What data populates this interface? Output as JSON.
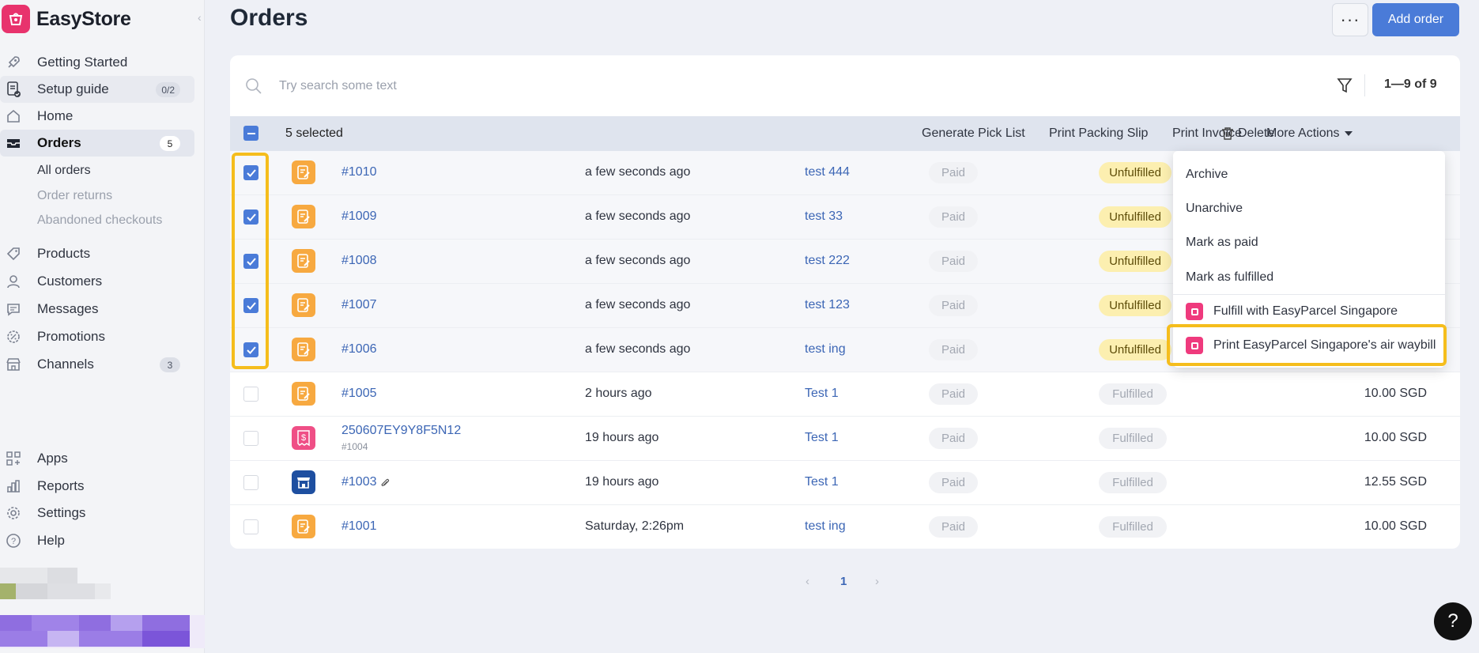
{
  "brand": {
    "name": "EasyStore"
  },
  "sidebar": {
    "items": [
      {
        "label": "Getting Started",
        "icon": "rocket-icon"
      },
      {
        "label": "Setup guide",
        "icon": "checklist-icon",
        "badge": "0/2"
      },
      {
        "label": "Home",
        "icon": "home-icon"
      },
      {
        "label": "Orders",
        "icon": "inbox-icon",
        "badge": "5"
      },
      {
        "label": "Products",
        "icon": "tag-icon"
      },
      {
        "label": "Customers",
        "icon": "user-icon"
      },
      {
        "label": "Messages",
        "icon": "chat-icon"
      },
      {
        "label": "Promotions",
        "icon": "gear-badge-icon"
      },
      {
        "label": "Channels",
        "icon": "store-icon",
        "badge": "3"
      },
      {
        "label": "Apps",
        "icon": "apps-icon"
      },
      {
        "label": "Reports",
        "icon": "chart-icon"
      },
      {
        "label": "Settings",
        "icon": "settings-icon"
      },
      {
        "label": "Help",
        "icon": "help-icon"
      }
    ],
    "orders_sub": [
      "All orders",
      "Order returns",
      "Abandoned checkouts"
    ]
  },
  "header": {
    "title": "Orders",
    "more_label": "···",
    "add_label": "Add order"
  },
  "search": {
    "placeholder": "Try search some text",
    "count": "1—9 of 9"
  },
  "bulk": {
    "selected": "5 selected",
    "actions": [
      "Generate Pick List",
      "Print Packing Slip",
      "Print Invoice",
      "More Actions",
      "Delete"
    ]
  },
  "orders": [
    {
      "id": "#1010",
      "time": "a few seconds ago",
      "customer": "test 444",
      "payment": "Paid",
      "fulfillment": "Unfulfilled",
      "selected": true
    },
    {
      "id": "#1009",
      "time": "a few seconds ago",
      "customer": "test 33",
      "payment": "Paid",
      "fulfillment": "Unfulfilled",
      "selected": true
    },
    {
      "id": "#1008",
      "time": "a few seconds ago",
      "customer": "test 222",
      "payment": "Paid",
      "fulfillment": "Unfulfilled",
      "selected": true
    },
    {
      "id": "#1007",
      "time": "a few seconds ago",
      "customer": "test 123",
      "payment": "Paid",
      "fulfillment": "Unfulfilled",
      "selected": true
    },
    {
      "id": "#1006",
      "time": "a few seconds ago",
      "customer": "test ing",
      "payment": "Paid",
      "fulfillment": "Unfulfilled",
      "selected": true
    },
    {
      "id": "#1005",
      "time": "2 hours ago",
      "customer": "Test 1",
      "payment": "Paid",
      "fulfillment": "Fulfilled",
      "total": "10.00 SGD",
      "selected": false
    },
    {
      "id": "250607EY9Y8F5N12",
      "sub": "#1004",
      "time": "19 hours ago",
      "customer": "Test 1",
      "payment": "Paid",
      "fulfillment": "Fulfilled",
      "total": "10.00 SGD",
      "selected": false
    },
    {
      "id": "#1003",
      "time": "19 hours ago",
      "customer": "Test 1",
      "payment": "Paid",
      "fulfillment": "Fulfilled",
      "total": "12.55 SGD",
      "selected": false
    },
    {
      "id": "#1001",
      "time": "Saturday, 2:26pm",
      "customer": "test ing",
      "payment": "Paid",
      "fulfillment": "Fulfilled",
      "total": "10.00 SGD",
      "selected": false
    }
  ],
  "more_actions": {
    "items": [
      "Archive",
      "Unarchive",
      "Mark as paid",
      "Mark as fulfilled"
    ],
    "plugins": [
      "Fulfill with EasyParcel Singapore",
      "Print EasyParcel Singapore's air waybill"
    ]
  },
  "pagination": {
    "page": "1"
  },
  "help": {
    "label": "?"
  },
  "colors": {
    "accent": "#4a7bd8",
    "highlight": "#f5bd1c",
    "order_icon": "#f7a940",
    "pos_icon": "#1e4fa0",
    "pink": "#ef3a7d"
  }
}
